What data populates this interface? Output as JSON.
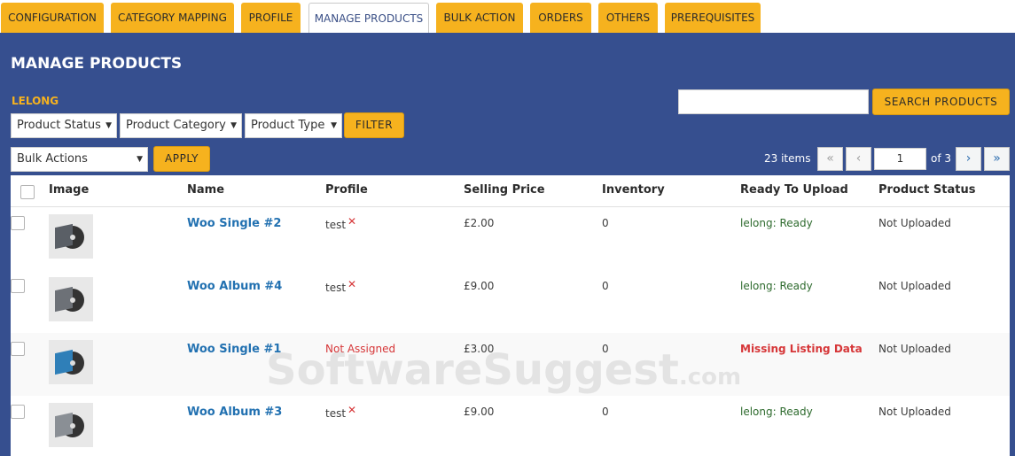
{
  "tabs": [
    {
      "label": "CONFIGURATION"
    },
    {
      "label": "CATEGORY MAPPING"
    },
    {
      "label": "PROFILE"
    },
    {
      "label": "MANAGE PRODUCTS"
    },
    {
      "label": "BULK ACTION"
    },
    {
      "label": "ORDERS"
    },
    {
      "label": "OTHERS"
    },
    {
      "label": "PREREQUISITES"
    }
  ],
  "page_title": "MANAGE PRODUCTS",
  "shop_label": "LELONG",
  "search": {
    "value": "",
    "button_label": "SEARCH PRODUCTS"
  },
  "filters": {
    "status_selected": "Product Status",
    "category_selected": "Product Category",
    "type_selected": "Product Type",
    "filter_label": "FILTER"
  },
  "bulk": {
    "selected": "Bulk Actions",
    "apply_label": "APPLY"
  },
  "pagination": {
    "items_count": "23 items",
    "first": "«",
    "prev": "‹",
    "current_page": "1",
    "of_text": "of 3",
    "next": "›",
    "last": "»"
  },
  "table": {
    "headers": {
      "image": "Image",
      "name": "Name",
      "profile": "Profile",
      "price": "Selling Price",
      "inventory": "Inventory",
      "ready": "Ready To Upload",
      "status": "Product Status"
    },
    "rows": [
      {
        "name": "Woo Single #2",
        "profile": "test",
        "price": "£2.00",
        "inventory": "0",
        "ready": "lelong: Ready",
        "status": "Not Uploaded"
      },
      {
        "name": "Woo Album #4",
        "profile": "test",
        "price": "£9.00",
        "inventory": "0",
        "ready": "lelong: Ready",
        "status": "Not Uploaded"
      },
      {
        "name": "Woo Single #1",
        "profile": "Not Assigned",
        "price": "£3.00",
        "inventory": "0",
        "ready": "Missing Listing Data",
        "status": "Not Uploaded"
      },
      {
        "name": "Woo Album #3",
        "profile": "test",
        "price": "£9.00",
        "inventory": "0",
        "ready": "lelong: Ready",
        "status": "Not Uploaded"
      }
    ]
  },
  "remove_mark": "✕",
  "select_caret": "▼",
  "watermark": {
    "main": "SoftwareSuggest",
    "suffix": ".com"
  },
  "colors": {
    "panel": "#364f8f",
    "accent": "#f6b21e",
    "link": "#2271b1",
    "error": "#d63638",
    "ready": "#2e6b2e"
  }
}
